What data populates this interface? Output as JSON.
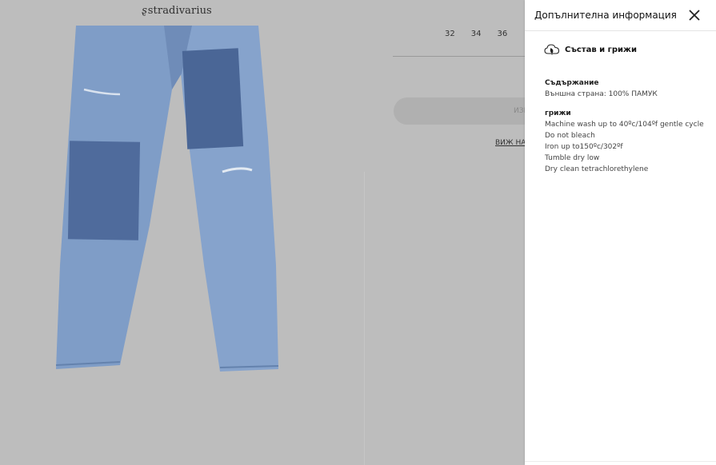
{
  "brand": {
    "name": "stradivarius",
    "mark": "ȿ"
  },
  "product": {
    "sizes": [
      "32",
      "34",
      "36"
    ],
    "add_button_label": "ИЗБ",
    "store_link_label": "ВИЖ НАЛ"
  },
  "panel": {
    "title": "Допълнителна информация",
    "section_title": "Състав и грижи",
    "composition": {
      "heading": "Съдържание",
      "line": "Външна страна: 100% ПАМУК"
    },
    "care": {
      "heading": "грижи",
      "items": [
        "Machine wash up to 40ºc/104ºf gentle cycle",
        "Do not bleach",
        "Iron up to150ºc/302ºf",
        "Tumble dry low",
        "Dry clean tetrachlorethylene"
      ]
    }
  },
  "icons": {
    "close": "close-icon",
    "section": "leaf-cloud-icon"
  },
  "colors": {
    "overlay": "#bdbdbd",
    "panel": "#ffffff",
    "denim": "#7f9dc7",
    "patch": "#4f6b9c"
  }
}
